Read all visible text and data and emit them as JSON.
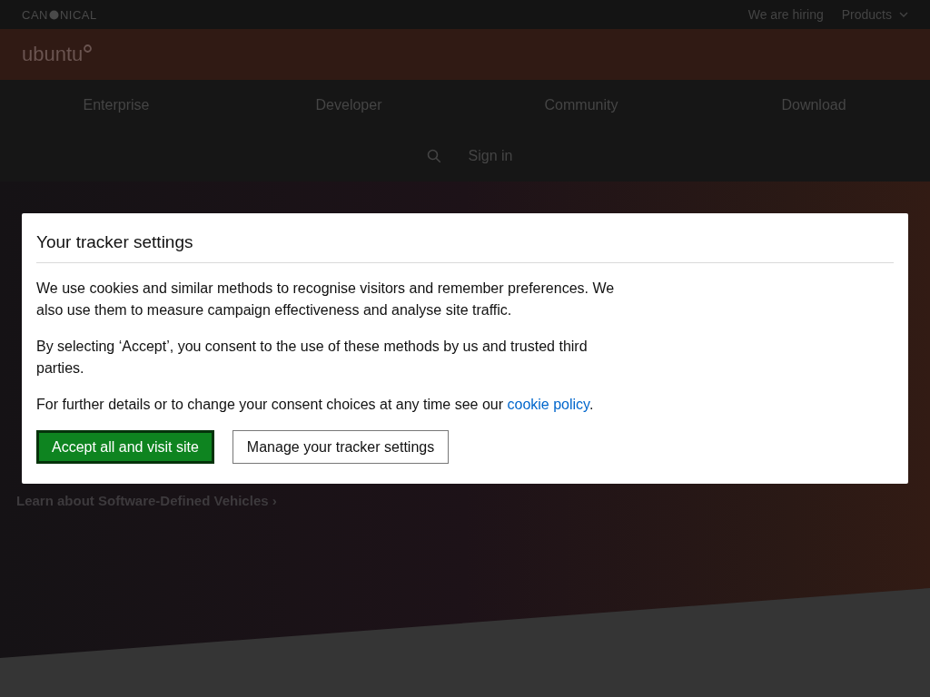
{
  "top_bar": {
    "logo_parts": [
      "CAN",
      "NICAL"
    ],
    "links": [
      {
        "label": "We are hiring",
        "kind": "link"
      },
      {
        "label": "Products",
        "kind": "dropdown"
      }
    ]
  },
  "brand_bar": {
    "logo": "ubuntu"
  },
  "nav": {
    "items": [
      "Enterprise",
      "Developer",
      "Community",
      "Download"
    ],
    "sign_in": "Sign in"
  },
  "hero": {
    "link": "Learn about Software-Defined Vehicles ›"
  },
  "dialog": {
    "title": "Your tracker settings",
    "paragraphs": [
      "We use cookies and similar methods to recognise visitors and remember preferences. We also use them to measure campaign effectiveness and analyse site traffic.",
      "By selecting ‘Accept’, you consent to the use of these methods by us and trusted third parties."
    ],
    "policy_line": {
      "text": "For further details or to change your consent choices at any time see our ",
      "link": "cookie policy",
      "after": "."
    },
    "buttons": [
      {
        "label": "Accept all and visit site",
        "kind": "primary"
      },
      {
        "label": "Manage your tracker settings",
        "kind": "secondary"
      }
    ]
  }
}
